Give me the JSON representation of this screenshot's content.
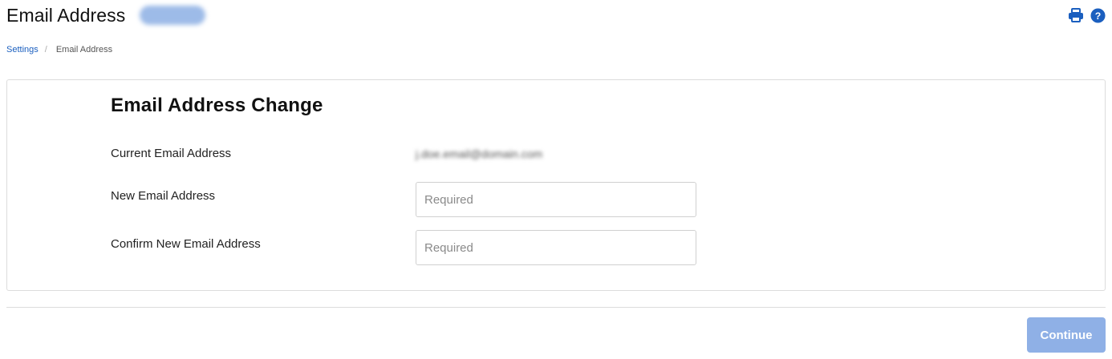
{
  "header": {
    "title": "Email Address",
    "badge_text": "",
    "print_icon": "printer-icon",
    "help_icon": "question-circle-icon",
    "accent_color": "#1b5fbf"
  },
  "breadcrumb": {
    "parent": "Settings",
    "separator": "/",
    "current": "Email Address"
  },
  "form": {
    "title": "Email Address Change",
    "current_email_label": "Current Email Address",
    "current_email_value": "j.doe.email@domain.com",
    "new_email_label": "New Email Address",
    "new_email_placeholder": "Required",
    "new_email_value": "",
    "confirm_email_label": "Confirm New Email Address",
    "confirm_email_placeholder": "Required",
    "confirm_email_value": ""
  },
  "footer": {
    "continue_label": "Continue",
    "continue_color": "#8fb0e6"
  }
}
